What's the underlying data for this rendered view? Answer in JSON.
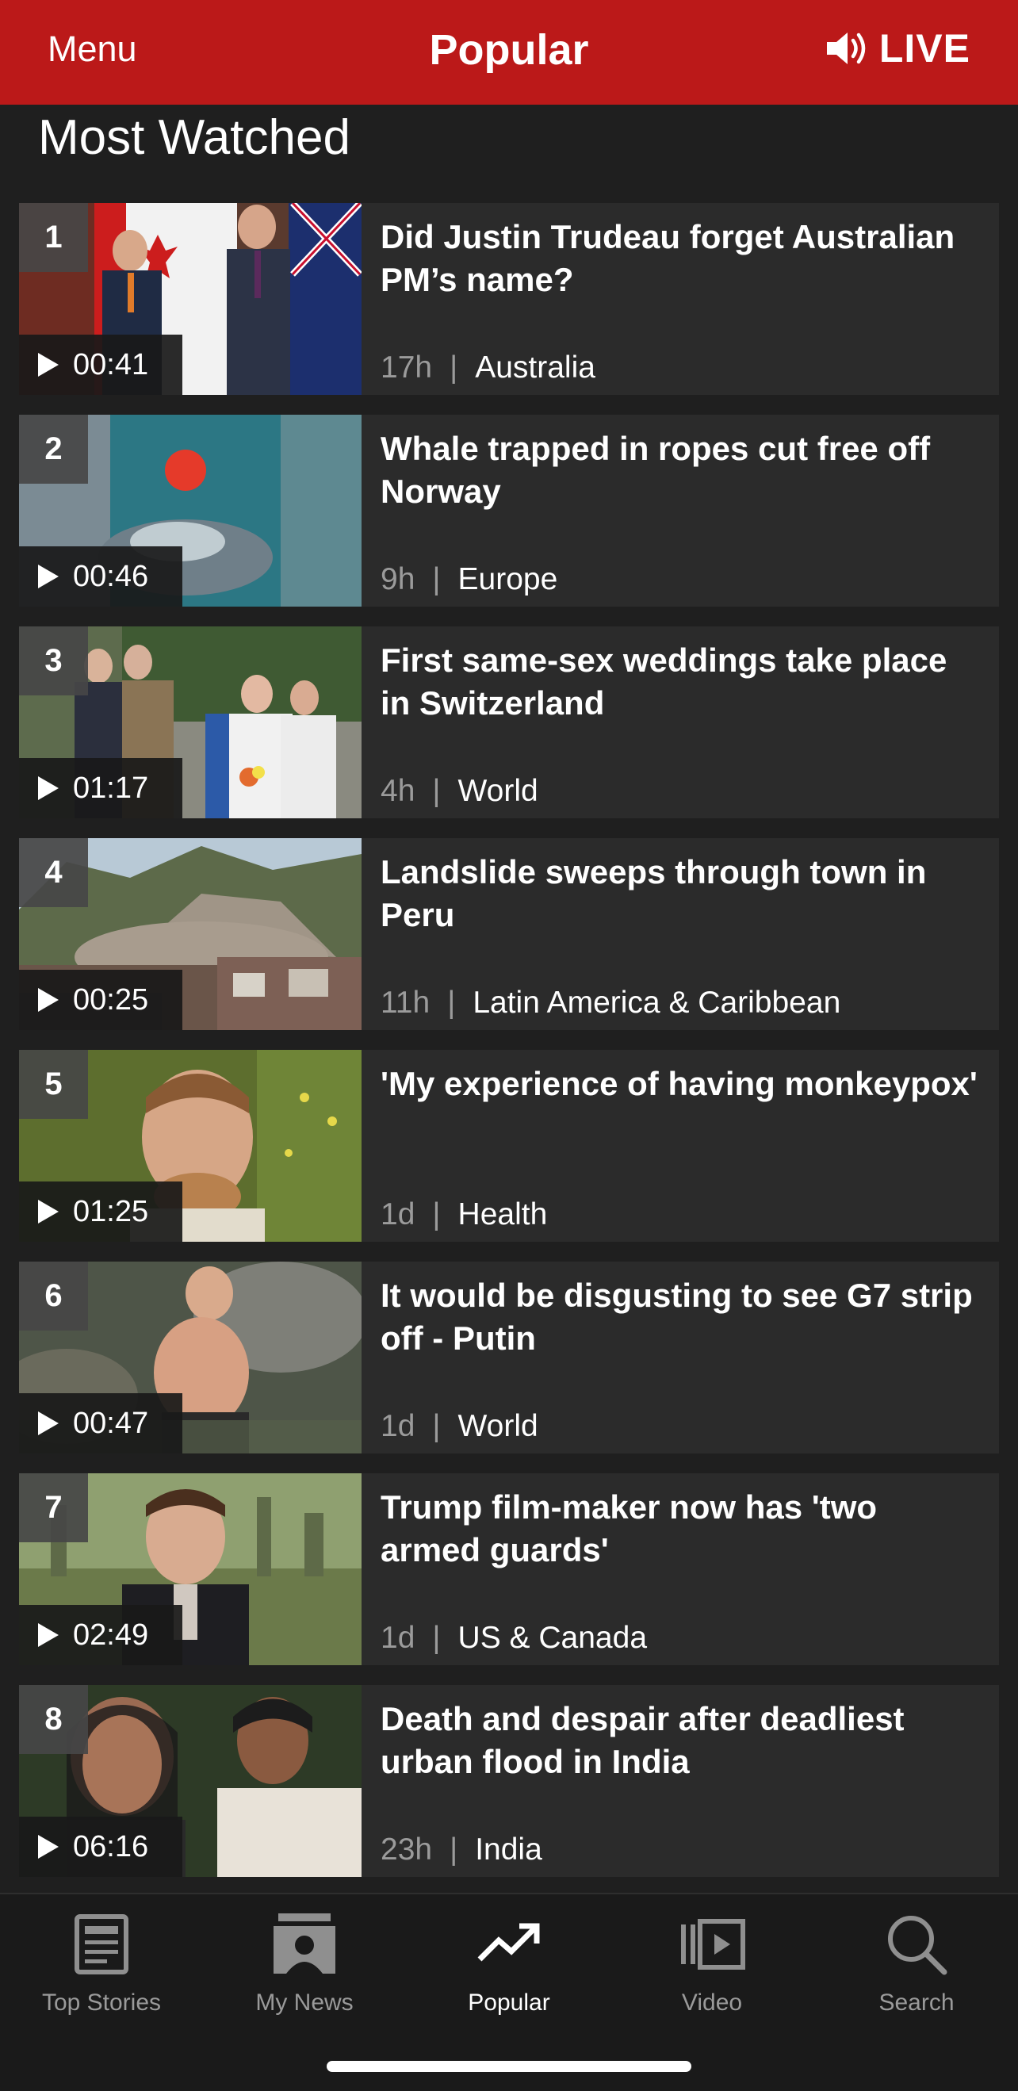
{
  "header": {
    "menu_label": "Menu",
    "title": "Popular",
    "live_label": "LIVE",
    "background": "#bb1919"
  },
  "section": {
    "title": "Most Watched"
  },
  "items": [
    {
      "rank": "1",
      "duration": "00:41",
      "title": "Did Justin Trudeau forget Australian PM’s name?",
      "age": "17h",
      "category": "Australia"
    },
    {
      "rank": "2",
      "duration": "00:46",
      "title": "Whale trapped in ropes cut free off Norway",
      "age": "9h",
      "category": "Europe"
    },
    {
      "rank": "3",
      "duration": "01:17",
      "title": "First same-sex weddings take place in Switzerland",
      "age": "4h",
      "category": "World"
    },
    {
      "rank": "4",
      "duration": "00:25",
      "title": "Landslide sweeps through town in Peru",
      "age": "11h",
      "category": "Latin America & Caribbean"
    },
    {
      "rank": "5",
      "duration": "01:25",
      "title": "'My experience of having monkeypox'",
      "age": "1d",
      "category": "Health"
    },
    {
      "rank": "6",
      "duration": "00:47",
      "title": "It would be disgusting to see G7 strip off - Putin",
      "age": "1d",
      "category": "World"
    },
    {
      "rank": "7",
      "duration": "02:49",
      "title": "Trump film-maker now has 'two armed guards'",
      "age": "1d",
      "category": "US & Canada"
    },
    {
      "rank": "8",
      "duration": "06:16",
      "title": "Death and despair after deadliest urban flood in India",
      "age": "23h",
      "category": "India"
    }
  ],
  "separator": "|",
  "nav": [
    {
      "label": "Top Stories",
      "icon": "newspaper-icon",
      "active": false
    },
    {
      "label": "My News",
      "icon": "my-news-icon",
      "active": false
    },
    {
      "label": "Popular",
      "icon": "trending-icon",
      "active": true
    },
    {
      "label": "Video",
      "icon": "video-icon",
      "active": false
    },
    {
      "label": "Search",
      "icon": "search-icon",
      "active": false
    }
  ]
}
